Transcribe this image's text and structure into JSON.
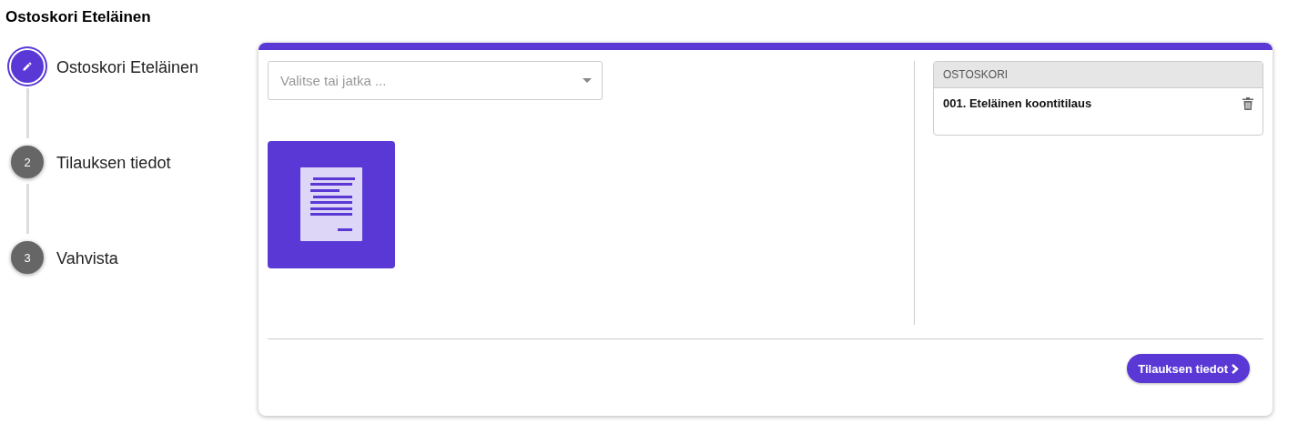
{
  "page_title": "Ostoskori Eteläinen",
  "steps": [
    {
      "label": "Ostoskori Eteläinen",
      "selected": true
    },
    {
      "number": "2",
      "label": "Tilauksen tiedot",
      "selected": false
    },
    {
      "number": "3",
      "label": "Vahvista",
      "selected": false
    }
  ],
  "select": {
    "placeholder": "Valitse tai jatka ..."
  },
  "tiles": [
    {
      "kind": "document"
    }
  ],
  "cart": {
    "heading": "OSTOSKORI",
    "items": [
      {
        "label": "001. Eteläinen koontitilaus"
      }
    ]
  },
  "next_button": {
    "label": "Tilauksen tiedot"
  }
}
